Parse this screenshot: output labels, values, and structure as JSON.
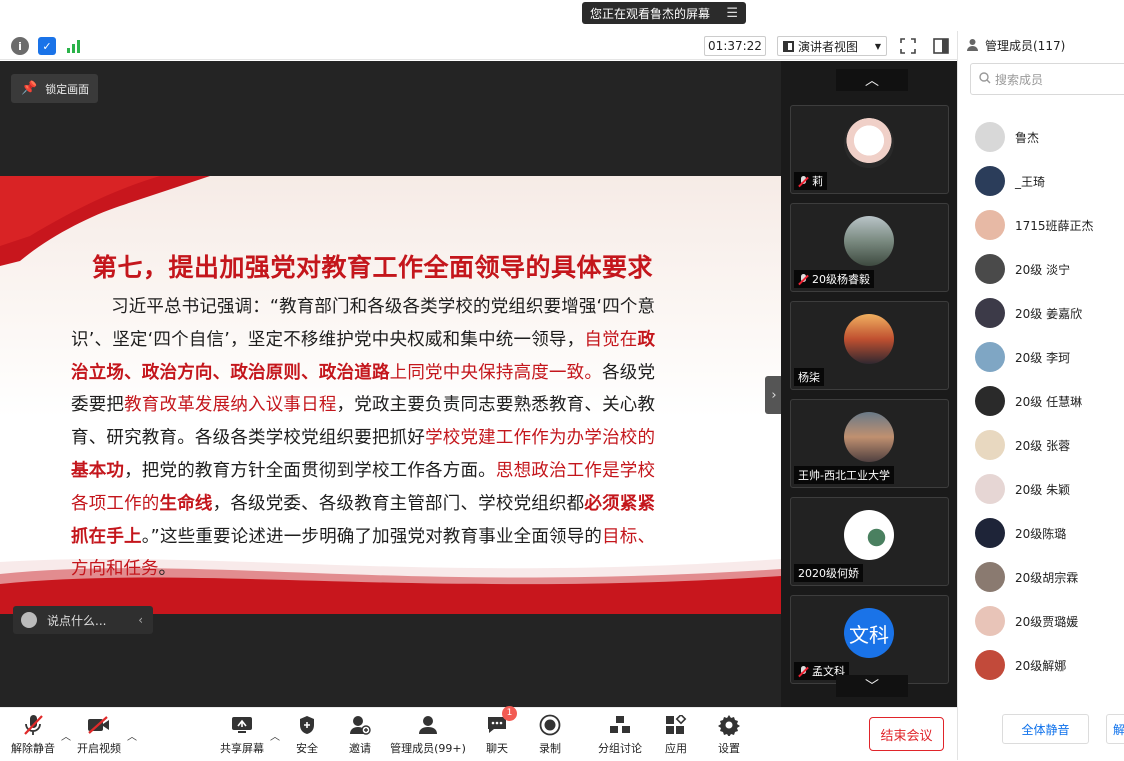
{
  "banner": {
    "text": "您正在观看鲁杰的屏幕",
    "menu_icon": "list-icon"
  },
  "toolbar": {
    "timer": "01:37:22",
    "view_mode": "演讲者视图"
  },
  "stage": {
    "lock_label": "锁定画面",
    "comment_placeholder": "说点什么..."
  },
  "slide": {
    "title": "第七，提出加强党对教育工作全面领导的具体要求",
    "segments": [
      {
        "t": "n",
        "s": "习近平总书记强调：“教育部门和各级各类学校的党组织要增强‘四个意识’、坚定‘四个自信’，坚定不移维护党中央权威和集中统一领导，"
      },
      {
        "t": "r",
        "s": "自觉在"
      },
      {
        "t": "rb",
        "s": "政治立场、政治方向、政治原则、政治道路"
      },
      {
        "t": "r",
        "s": "上同党中央保持高度一致。"
      },
      {
        "t": "n",
        "s": "各级党委要把"
      },
      {
        "t": "r",
        "s": "教育改革发展纳入议事日程"
      },
      {
        "t": "n",
        "s": "，党政主要负责同志要熟悉教育、关心教育、研究教育。各级各类学校党组织要把抓好"
      },
      {
        "t": "r",
        "s": "学校党建工作作为办学治校的"
      },
      {
        "t": "rb",
        "s": "基本功"
      },
      {
        "t": "n",
        "s": "，把党的教育方针全面贯彻到学校工作各方面。"
      },
      {
        "t": "r",
        "s": "思想政治工作是学校各项工作的"
      },
      {
        "t": "rb",
        "s": "生命线"
      },
      {
        "t": "n",
        "s": "，各级党委、各级教育主管部门、学校党组织都"
      },
      {
        "t": "rb",
        "s": "必须紧紧抓在手上"
      },
      {
        "t": "n",
        "s": "。”这些重要论述进一步明确了加强党对教育事业全面领导的"
      },
      {
        "t": "r",
        "s": "目标、方向和任务"
      },
      {
        "t": "n",
        "s": "。"
      }
    ]
  },
  "gallery": {
    "tiles": [
      {
        "name": "莉",
        "muted": true
      },
      {
        "name": "20级杨睿毅",
        "muted": true
      },
      {
        "name": "杨柒",
        "muted": false
      },
      {
        "name": "王帅-西北工业大学",
        "muted": false
      },
      {
        "name": "2020级何娇",
        "muted": false
      },
      {
        "name": "孟文科",
        "muted": true,
        "avatar_text": "文科"
      }
    ]
  },
  "bottombar": {
    "unmute": "解除静音",
    "start_video": "开启视频",
    "share_screen": "共享屏幕",
    "security": "安全",
    "invite": "邀请",
    "manage_members": "管理成员(99+)",
    "chat": "聊天",
    "chat_badge": "1",
    "record": "录制",
    "breakout": "分组讨论",
    "apps": "应用",
    "settings": "设置",
    "end_meeting": "结束会议"
  },
  "sidepanel": {
    "title": "管理成员(117)",
    "search_placeholder": "搜索成员",
    "members": [
      {
        "name": "鲁杰",
        "color": "#d8d8d8"
      },
      {
        "name": "_王琦",
        "color": "#2b3d5a"
      },
      {
        "name": "1715班薛正杰",
        "color": "#e7b9a5"
      },
      {
        "name": "20级 淡宁",
        "color": "#4a4a4a"
      },
      {
        "name": "20级 姜嘉欣",
        "color": "#3c3a48"
      },
      {
        "name": "20级 李珂",
        "color": "#7fa6c4"
      },
      {
        "name": "20级 任慧琳",
        "color": "#2a2a2a"
      },
      {
        "name": "20级 张蓉",
        "color": "#e8d8c0"
      },
      {
        "name": "20级 朱颖",
        "color": "#e6d6d4"
      },
      {
        "name": "20级陈璐",
        "color": "#1e2438"
      },
      {
        "name": "20级胡宗霖",
        "color": "#8a7a70"
      },
      {
        "name": "20级贾璐媛",
        "color": "#e8c4b8"
      },
      {
        "name": "20级解娜",
        "color": "#c24a3a"
      }
    ],
    "mute_all": "全体静音",
    "unmute_all_partial": "解"
  }
}
